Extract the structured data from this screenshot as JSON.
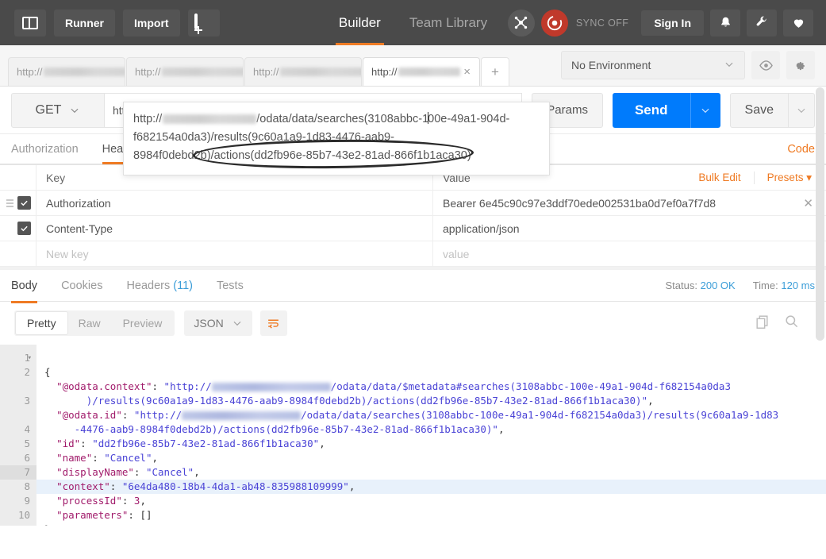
{
  "header": {
    "buttons": [
      {
        "name": "sidebar-toggle",
        "label": ""
      },
      {
        "name": "runner",
        "label": "Runner"
      },
      {
        "name": "import",
        "label": "Import"
      },
      {
        "name": "new-tab",
        "label": ""
      }
    ],
    "runner_label": "Runner",
    "import_label": "Import",
    "tabs": [
      {
        "label": "Builder",
        "active": true
      },
      {
        "label": "Team Library",
        "active": false
      }
    ],
    "builder_label": "Builder",
    "team_library_label": "Team Library",
    "sync_label": "SYNC OFF",
    "sign_in_label": "Sign In",
    "accent_color": "#ef7b24",
    "background_color": "#4a4a4a",
    "sync_color": "#c0392b"
  },
  "request_tabs": {
    "items": [
      {
        "prefix": "http://",
        "redacted_width": 140,
        "active": false
      },
      {
        "prefix": "http://",
        "redacted_width": 138,
        "active": false
      },
      {
        "prefix": "http://",
        "redacted_width": 134,
        "active": false
      },
      {
        "prefix": "http://",
        "redacted_width": 86,
        "active": true
      }
    ],
    "close_label": "×",
    "add_label": "+"
  },
  "environment": {
    "selected": "No Environment",
    "eye_icon": "eye-icon",
    "gear_icon": "gear-icon"
  },
  "url_bar": {
    "method": "GET",
    "url_prefix": "http://",
    "url_rest": "/odata/data/searches(3108abbc-100e-49a1-904d-f682154a0da3)/results(9c60a1a9-1d83-4476-aab9-8984f0debd2b)/actions(dd2fb96e-85b7-43e2-81ad-866f1b1aca30)",
    "params_label": "Params",
    "send_label": "Send",
    "save_label": "Save",
    "send_color": "#007bfc"
  },
  "url_dropdown": {
    "line1_prefix": "http://",
    "line1_suffix": "/odata/data/searches(3108abbc-1",
    "line1_tail": "00e-49a1-904d-",
    "line2": "f682154a0da3)/results(9c60a1a9-1d83-4476-aab9-",
    "line3_head": "8984f0debd2b",
    "line3_tail": ")/actions(dd2fb96e-85b7-43e2-81ad-866f1b1aca30)",
    "annotation": "hand-drawn-ellipse"
  },
  "request_tabs_row": {
    "items": [
      {
        "label": "Authorization",
        "active": false
      },
      {
        "label": "Headers",
        "active": true
      }
    ],
    "authorization_label": "Authorization",
    "headers_label": "Headers",
    "code_label": "Code"
  },
  "headers_table": {
    "columns": {
      "key": "Key",
      "value": "Value"
    },
    "bulk_edit_label": "Bulk Edit",
    "presets_label": "Presets",
    "rows": [
      {
        "checked": true,
        "key": "Authorization",
        "value": "Bearer 6e45c90c97e3ddf70ede002531ba0d7ef0a7f7d8",
        "has_drag_handle": true,
        "has_remove": true
      },
      {
        "checked": true,
        "key": "Content-Type",
        "value": "application/json",
        "has_drag_handle": false,
        "has_remove": false
      }
    ],
    "new_row": {
      "key_placeholder": "New key",
      "value_placeholder": "value"
    }
  },
  "response": {
    "tabs": [
      {
        "label": "Body",
        "active": true,
        "count": null
      },
      {
        "label": "Cookies",
        "active": false,
        "count": null
      },
      {
        "label": "Headers",
        "active": false,
        "count": "(11)"
      },
      {
        "label": "Tests",
        "active": false,
        "count": null
      }
    ],
    "body_label": "Body",
    "cookies_label": "Cookies",
    "headers_label": "Headers",
    "headers_count": "(11)",
    "tests_label": "Tests",
    "status_label": "Status:",
    "status_value": "200 OK",
    "time_label": "Time:",
    "time_value": "120 ms",
    "status_color": "#3b9dd8"
  },
  "format_bar": {
    "modes": [
      {
        "label": "Pretty",
        "active": true
      },
      {
        "label": "Raw",
        "active": false
      },
      {
        "label": "Preview",
        "active": false
      }
    ],
    "pretty_label": "Pretty",
    "raw_label": "Raw",
    "preview_label": "Preview",
    "language": "JSON",
    "wrap_icon": "word-wrap-icon",
    "copy_icon": "copy-icon",
    "search_icon": "search-icon"
  },
  "code_viewer": {
    "line_numbers": [
      "1",
      "2",
      "3",
      "4",
      "5",
      "6",
      "7",
      "8",
      "9",
      "10"
    ],
    "highlighted_line": 7,
    "lines": [
      {
        "num": "1",
        "text": "{"
      },
      {
        "num": "2",
        "text": "  \"@odata.context\": \"http://[REDACTED]/odata/data/$metadata#searches(3108abbc-100e-49a1-904d-f682154a0da3)/results(9c60a1a9-1d83-4476-aab9-8984f0debd2b)/actions(dd2fb96e-85b7-43e2-81ad-866f1b1aca30)\","
      },
      {
        "num": "3",
        "text": "  \"@odata.id\": \"http://[REDACTED]/odata/data/searches(3108abbc-100e-49a1-904d-f682154a0da3)/results(9c60a1a9-1d83-4476-aab9-8984f0debd2b)/actions(dd2fb96e-85b7-43e2-81ad-866f1b1aca30)\","
      },
      {
        "num": "4",
        "text": "  \"id\": \"dd2fb96e-85b7-43e2-81ad-866f1b1aca30\","
      },
      {
        "num": "5",
        "text": "  \"name\": \"Cancel\","
      },
      {
        "num": "6",
        "text": "  \"displayName\": \"Cancel\","
      },
      {
        "num": "7",
        "text": "  \"context\": \"6e4da480-18b4-4da1-ab48-835988109999\","
      },
      {
        "num": "8",
        "text": "  \"processId\": 3,"
      },
      {
        "num": "9",
        "text": "  \"parameters\": []"
      },
      {
        "num": "10",
        "text": "}"
      }
    ],
    "tokens": {
      "l2_key": "\"@odata.context\"",
      "l2_s1": "\"http://",
      "l2_s2": "/odata/data/$metadata#searches(3108abbc-100e-49a1-904d-f682154a0da3",
      "l2_s3": ")/results(9c60a1a9-1d83-4476-aab9-8984f0debd2b)/actions(dd2fb96e-85b7-43e2-81ad-866f1b1aca30)\"",
      "l3_key": "\"@odata.id\"",
      "l3_s1": "\"http://",
      "l3_s2": "/odata/data/searches(3108abbc-100e-49a1-904d-f682154a0da3)/results(9c60a1a9-1d83",
      "l3_s3": "-4476-aab9-8984f0debd2b)/actions(dd2fb96e-85b7-43e2-81ad-866f1b1aca30)\"",
      "l4_key": "\"id\"",
      "l4_val": "\"dd2fb96e-85b7-43e2-81ad-866f1b1aca30\"",
      "l5_key": "\"name\"",
      "l5_val": "\"Cancel\"",
      "l6_key": "\"displayName\"",
      "l6_val": "\"Cancel\"",
      "l7_key": "\"context\"",
      "l7_val": "\"6e4da480-18b4-4da1-ab48-835988109999\"",
      "l8_key": "\"processId\"",
      "l8_val": "3",
      "l9_key": "\"parameters\"",
      "l9_val": "[]",
      "open_brace": "{",
      "close_brace": "}",
      "comma": ",",
      "colon": ": "
    }
  }
}
